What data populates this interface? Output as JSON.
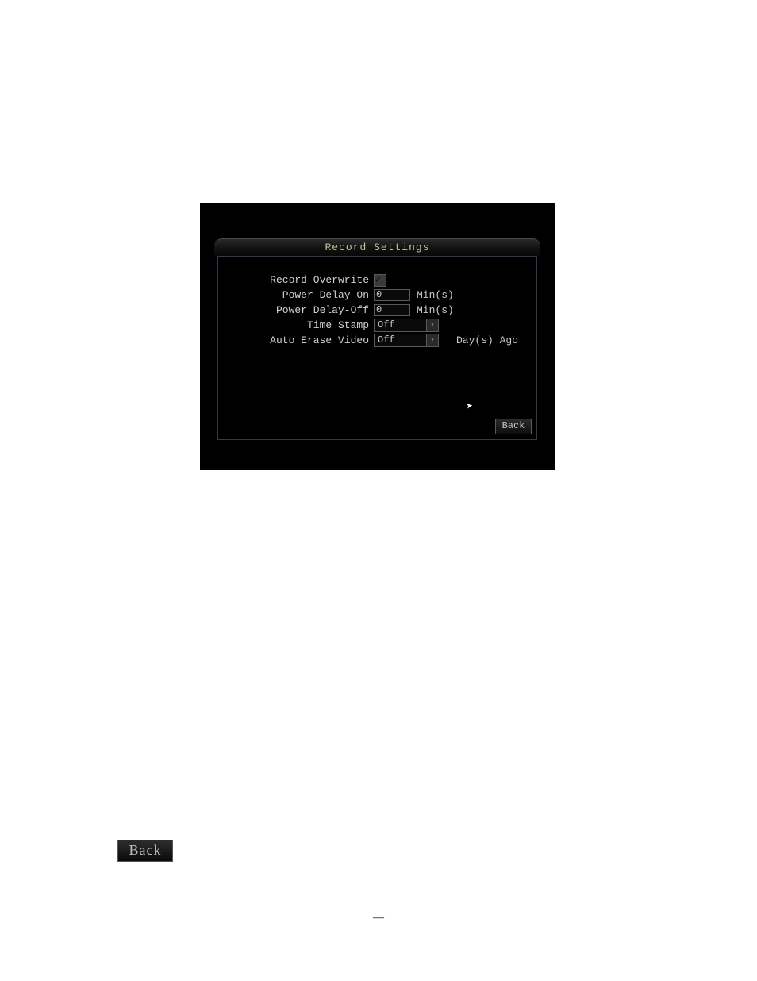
{
  "dialog": {
    "title": "Record Settings",
    "rows": {
      "overwrite": {
        "label": "Record Overwrite"
      },
      "delay_on": {
        "label": "Power Delay-On",
        "value": "0",
        "unit": "Min(s)"
      },
      "delay_off": {
        "label": "Power Delay-Off",
        "value": "0",
        "unit": "Min(s)"
      },
      "timestamp": {
        "label": "Time Stamp",
        "value": "Off"
      },
      "erase": {
        "label": "Auto Erase Video",
        "value": "Off",
        "unit": "Day(s) Ago"
      }
    },
    "back": "Back"
  },
  "standalone_back": "Back",
  "page_marker": "—"
}
